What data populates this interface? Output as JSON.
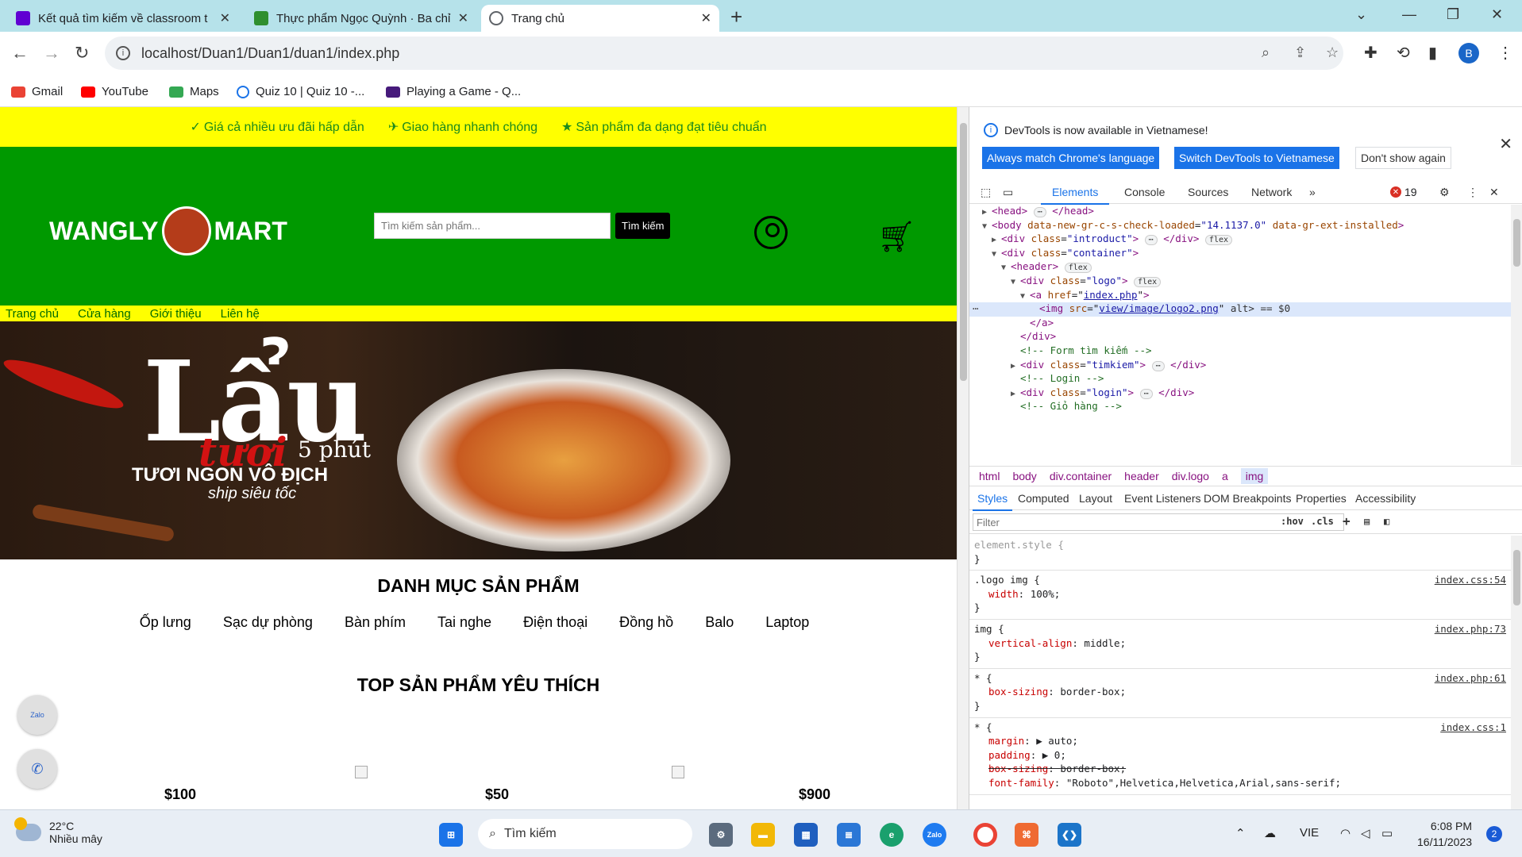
{
  "browser": {
    "tabs": [
      {
        "title": "Kết quả tìm kiếm về classroom t",
        "favicon_color": "#6001d2",
        "active": false
      },
      {
        "title": "Thực phẩm Ngọc Quỳnh · Ba chỉ",
        "favicon_color": "#2f8f2f",
        "active": false
      },
      {
        "title": "Trang chủ",
        "favicon_color": "#5f6368",
        "active": true
      }
    ],
    "address": "localhost/Duan1/Duan1/duan1/index.php",
    "profile_initial": "B",
    "bookmarks": [
      {
        "label": "Gmail",
        "color": "#ea4335"
      },
      {
        "label": "YouTube",
        "color": "#ff0000"
      },
      {
        "label": "Maps",
        "color": "#34a853"
      },
      {
        "label": "Quiz 10 | Quiz 10 -...",
        "color": "#1a73e8"
      },
      {
        "label": "Playing a Game - Q...",
        "color": "#461a7b"
      }
    ]
  },
  "site": {
    "introduct": [
      {
        "icon": "✓",
        "text": "Giá cả nhiều ưu đãi hấp dẫn"
      },
      {
        "icon": "✈",
        "text": "Giao hàng nhanh chóng"
      },
      {
        "icon": "★",
        "text": "Sản phẩm đa dạng đạt tiêu chuẩn"
      }
    ],
    "logo_left": "WANGLY",
    "logo_right": "MART",
    "search_placeholder": "Tìm kiếm sản phẩm...",
    "search_button": "Tìm kiếm",
    "menu": [
      "Trang chủ",
      "Cửa hàng",
      "Giới thiệu",
      "Liên hệ"
    ],
    "banner": {
      "big": "Lẩu",
      "tuoi": "tươi",
      "minutes": "5 phút",
      "slogan": "TƯƠI NGON VÔ ĐỊCH",
      "ship": "ship siêu tốc"
    },
    "category_title": "DANH MỤC SẢN PHẨM",
    "categories": [
      "Ốp lưng",
      "Sạc dự phòng",
      "Bàn phím",
      "Tai nghe",
      "Điện thoại",
      "Đồng hồ",
      "Balo",
      "Laptop"
    ],
    "top_title": "TOP SẢN PHẨM YÊU THÍCH",
    "prices": [
      "$100",
      "$50",
      "$900"
    ],
    "zalo_label": "Zalo"
  },
  "devtools": {
    "info_text": "DevTools is now available in Vietnamese!",
    "btn_match": "Always match Chrome's language",
    "btn_switch": "Switch DevTools to Vietnamese",
    "btn_dont": "Don't show again",
    "tabs": [
      "Elements",
      "Console",
      "Sources",
      "Network"
    ],
    "error_count": "19",
    "breadcrumbs": [
      "html",
      "body",
      "div.container",
      "header",
      "div.logo",
      "a",
      "img"
    ],
    "style_tabs": [
      "Styles",
      "Computed",
      "Layout",
      "Event Listeners",
      "DOM Breakpoints",
      "Properties",
      "Accessibility"
    ],
    "filter_placeholder": "Filter",
    "hov": ":hov",
    "cls": ".cls",
    "dom": {
      "head": "<head>",
      "head_close": "</head>",
      "body_open": "<body",
      "body_attr1": "data-new-gr-c-s-check-loaded",
      "body_val1": "\"14.1137.0\"",
      "body_attr2": "data-gr-ext-installed",
      "div_introduct": "\"introduct\"",
      "div_container": "\"container\"",
      "div_logo": "\"logo\"",
      "a_href": "index.php",
      "img_src": "view/image/logo2.png",
      "img_tail": " alt> == $0",
      "comment_search": "<!-- Form tìm kiếm -->",
      "div_timkiem": "\"timkiem\"",
      "comment_login": "<!-- Login -->",
      "div_login": "\"login\"",
      "comment_cart": "<!-- Giỏ hàng -->",
      "flex": "flex"
    },
    "rules": {
      "element_style": "element.style {",
      "r1_sel": ".logo img {",
      "r1_src": "index.css:54",
      "r1_prop": "width",
      "r1_val": "100%;",
      "r2_sel": "img {",
      "r2_src": "index.php:73",
      "r2_prop": "vertical-align",
      "r2_val": "middle;",
      "r3_sel": "* {",
      "r3_src": "index.php:61",
      "r3_prop": "box-sizing",
      "r3_val": "border-box;",
      "r4_sel": "* {",
      "r4_src": "index.css:1",
      "r4_p1": "margin",
      "r4_v1": "auto;",
      "r4_p2": "padding",
      "r4_v2": "0;",
      "r4_p3": "box-sizing",
      "r4_v3": "border-box;",
      "r4_p4": "font-family",
      "r4_v4": "\"Roboto\",Helvetica,Helvetica,Arial,sans-serif;"
    }
  },
  "taskbar": {
    "temp": "22°C",
    "weather": "Nhiều mây",
    "search": "Tìm kiếm",
    "lang": "VIE",
    "time": "6:08 PM",
    "date": "16/11/2023",
    "notifications": "2"
  }
}
